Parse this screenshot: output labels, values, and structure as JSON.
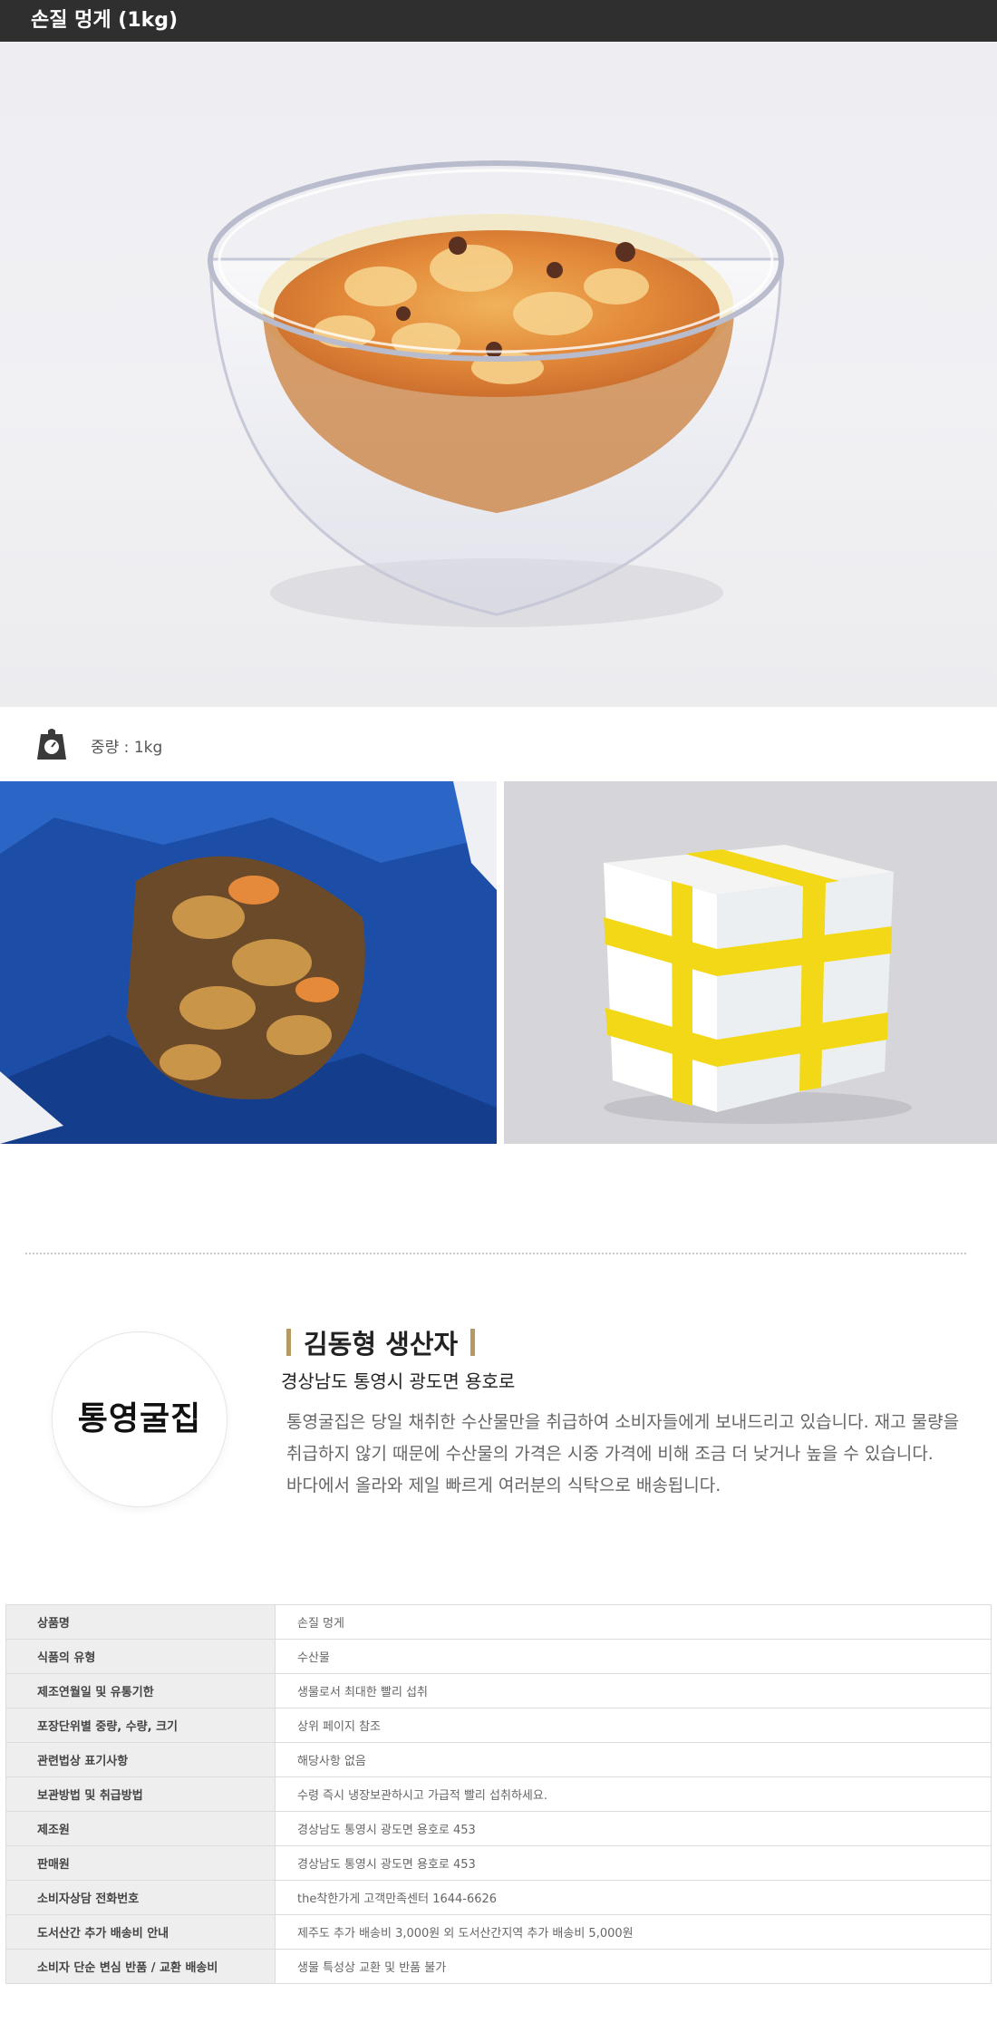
{
  "header": {
    "title": "손질 멍게 (1kg)"
  },
  "product_info": {
    "weight_label": "중량 : 1kg"
  },
  "producer": {
    "logo_text": "통영굴집",
    "name": "김동형 생산자",
    "address": "경상남도 통영시 광도면 용호로",
    "description": [
      "통영굴집은 당일 채취한 수산물만을 취급하여 소비자들에게 보내드리고 있습니다. 재고 물량을",
      "취급하지 않기 때문에 수산물의 가격은 시중 가격에 비해 조금 더 낮거나 높을 수 있습니다.",
      "바다에서 올라와 제일 빠르게 여러분의 식탁으로 배송됩니다."
    ]
  },
  "info_table": [
    {
      "label": "상품명",
      "value": "손질 멍게"
    },
    {
      "label": "식품의 유형",
      "value": "수산물"
    },
    {
      "label": "제조연월일 및 유통기한",
      "value": "생물로서 최대한 빨리 섭취"
    },
    {
      "label": "포장단위별 중량, 수량, 크기",
      "value": "상위 페이지 참조"
    },
    {
      "label": "관련법상 표기사항",
      "value": "해당사항 없음"
    },
    {
      "label": "보관방법 및 취급방법",
      "value": "수령 즉시 냉장보관하시고 가급적 빨리 섭취하세요."
    },
    {
      "label": "제조원",
      "value": "경상남도 통영시 광도면 용호로 453"
    },
    {
      "label": "판매원",
      "value": "경상남도 통영시 광도면 용호로 453"
    },
    {
      "label": "소비자상담 전화번호",
      "value": "the착한가게 고객만족센터 1644-6626"
    },
    {
      "label": "도서산간 추가 배송비 안내",
      "value": "제주도 추가 배송비 3,000원 외 도서산간지역 추가 배송비 5,000원"
    },
    {
      "label": "소비자 단순 변심 반품 / 교환 배송비",
      "value": "생물 특성상 교환 및 반품 불가"
    }
  ]
}
